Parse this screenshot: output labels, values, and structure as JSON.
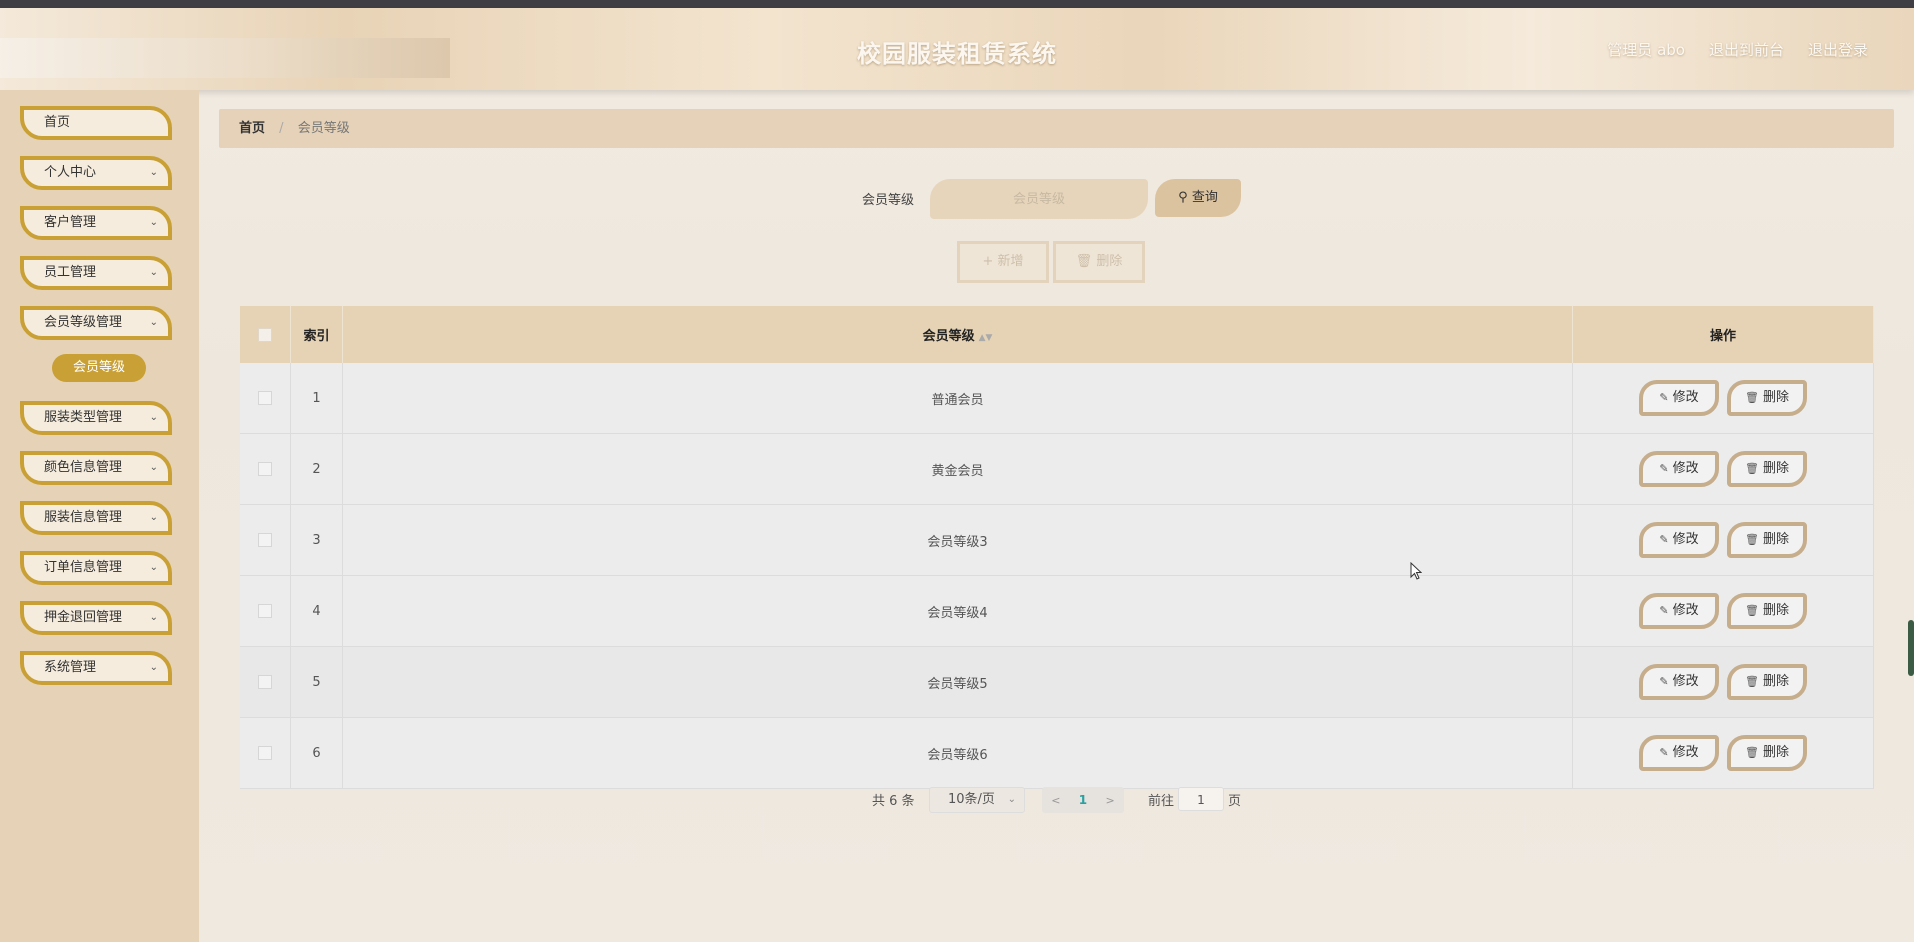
{
  "header": {
    "title": "校园服装租赁系统",
    "user": "管理员 abo",
    "to_front": "退出到前台",
    "logout": "退出登录"
  },
  "sidebar": {
    "items": [
      {
        "label": "首页",
        "has_children": false
      },
      {
        "label": "个人中心",
        "has_children": true
      },
      {
        "label": "客户管理",
        "has_children": true
      },
      {
        "label": "员工管理",
        "has_children": true
      },
      {
        "label": "会员等级管理",
        "has_children": true
      },
      {
        "label": "服装类型管理",
        "has_children": true
      },
      {
        "label": "颜色信息管理",
        "has_children": true
      },
      {
        "label": "服装信息管理",
        "has_children": true
      },
      {
        "label": "订单信息管理",
        "has_children": true
      },
      {
        "label": "押金退回管理",
        "has_children": true
      },
      {
        "label": "系统管理",
        "has_children": true
      }
    ],
    "active_sub": "会员等级"
  },
  "breadcrumb": {
    "home": "首页",
    "separator": "/",
    "current": "会员等级"
  },
  "search": {
    "label": "会员等级",
    "placeholder": "会员等级",
    "query_button": "查询"
  },
  "actions": {
    "add": "新增",
    "delete": "删除"
  },
  "table": {
    "headers": {
      "index": "索引",
      "level": "会员等级",
      "operation": "操作"
    },
    "rows": [
      {
        "index": "1",
        "level": "普通会员"
      },
      {
        "index": "2",
        "level": "黄金会员"
      },
      {
        "index": "3",
        "level": "会员等级3"
      },
      {
        "index": "4",
        "level": "会员等级4"
      },
      {
        "index": "5",
        "level": "会员等级5"
      },
      {
        "index": "6",
        "level": "会员等级6"
      }
    ],
    "edit_label": "修改",
    "delete_label": "删除"
  },
  "pagination": {
    "total": "共 6 条",
    "page_size": "10条/页",
    "current_page": "1",
    "goto_label": "前往",
    "goto_value": "1",
    "page_unit": "页"
  },
  "colors": {
    "accent": "#c9a035",
    "header_bg": "#e8d3b6",
    "table_header": "#e6d3b6"
  }
}
